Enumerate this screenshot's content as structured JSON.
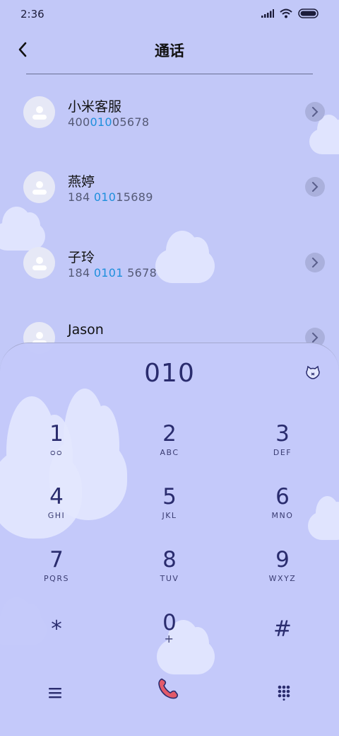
{
  "status_bar": {
    "time": "2:36"
  },
  "header": {
    "title": "通话"
  },
  "contacts": [
    {
      "name": "小米客服",
      "num_pre": "400",
      "num_hl": "010",
      "num_post": "05678"
    },
    {
      "name": "燕婷",
      "num_pre": "184 ",
      "num_hl": "010",
      "num_post": "15689"
    },
    {
      "name": "子玲",
      "num_pre": "184 ",
      "num_hl": "0101",
      "num_post": " 5678"
    },
    {
      "name": "Jason",
      "num_pre": "",
      "num_hl": "",
      "num_post": ""
    }
  ],
  "dialer": {
    "display": "010",
    "keys": [
      {
        "digit": "1",
        "letters": "ᴑᴑ"
      },
      {
        "digit": "2",
        "letters": "ABC"
      },
      {
        "digit": "3",
        "letters": "DEF"
      },
      {
        "digit": "4",
        "letters": "GHI"
      },
      {
        "digit": "5",
        "letters": "JKL"
      },
      {
        "digit": "6",
        "letters": "MNO"
      },
      {
        "digit": "7",
        "letters": "PQRS"
      },
      {
        "digit": "8",
        "letters": "TUV"
      },
      {
        "digit": "9",
        "letters": "WXYZ"
      },
      {
        "digit": "*",
        "letters": ""
      },
      {
        "digit": "0",
        "letters": "+"
      },
      {
        "digit": "#",
        "letters": ""
      }
    ]
  },
  "icons": {
    "back": "back-arrow-icon",
    "menu": "menu-icon",
    "call": "phone-icon",
    "keypad": "keypad-icon",
    "side": "cat-face-icon"
  },
  "colors": {
    "background": "#c2c8f8",
    "accent": "#1e8fdc",
    "dial_text": "#2a2c6e",
    "call_button": "#e25a6a"
  }
}
